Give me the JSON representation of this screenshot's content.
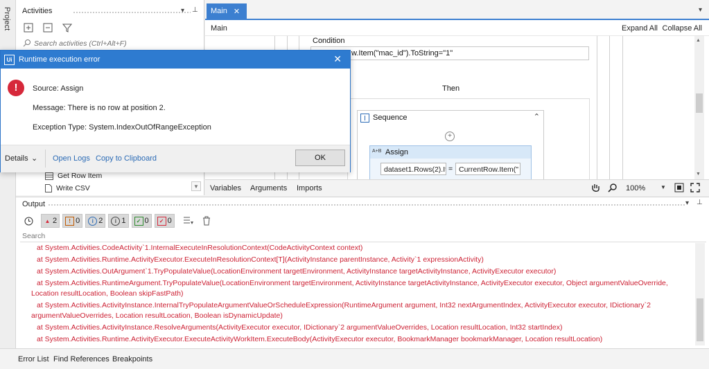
{
  "left_strip": {
    "label": "Project"
  },
  "activities": {
    "title": "Activities",
    "search_placeholder": "Search activities (Ctrl+Alt+F)",
    "items": [
      "Get Row Item",
      "Write CSV"
    ]
  },
  "designer": {
    "tab": "Main",
    "breadcrumb": "Main",
    "expand_all": "Expand All",
    "collapse_all": "Collapse All",
    "condition_label": "Condition",
    "condition_text": "w.Item(\"mac_id\").ToString=\"1\"",
    "then_label": "Then",
    "sequence_label": "Sequence",
    "assign_label": "Assign",
    "assign_icon": "A+B",
    "assign_to": "dataset1.Rows(2).It",
    "assign_eq": "=",
    "assign_value": "CurrentRow.Item(\"",
    "bottom_tabs": [
      "Variables",
      "Arguments",
      "Imports"
    ],
    "zoom": "100%"
  },
  "dialog": {
    "logo": "Ui",
    "title": "Runtime execution error",
    "source": "Source: Assign",
    "message": "Message: There is no row at position 2.",
    "exception": "Exception Type: System.IndexOutOfRangeException",
    "details": "Details",
    "open_logs": "Open Logs",
    "copy_clipboard": "Copy to Clipboard",
    "ok": "OK"
  },
  "output": {
    "title": "Output",
    "filters": [
      {
        "icon": "error-triangle-icon",
        "count": "2",
        "color": "#d6283a",
        "on": true
      },
      {
        "icon": "warning-icon",
        "count": "0",
        "color": "#c05a00",
        "on": true
      },
      {
        "icon": "info-icon",
        "count": "2",
        "color": "#2a6ab5",
        "on": true
      },
      {
        "icon": "trace-icon",
        "count": "1",
        "color": "#444444",
        "on": true
      },
      {
        "icon": "success-check-icon",
        "count": "0",
        "color": "#2d8a2d",
        "on": true
      },
      {
        "icon": "failed-check-icon",
        "count": "0",
        "color": "#d6283a",
        "on": true
      }
    ],
    "search_placeholder": "Search",
    "lines": [
      "at System.Activities.CodeActivity`1.InternalExecuteInResolutionContext(CodeActivityContext context)",
      "at System.Activities.Runtime.ActivityExecutor.ExecuteInResolutionContext[T](ActivityInstance parentInstance, Activity`1 expressionActivity)",
      "at System.Activities.OutArgument`1.TryPopulateValue(LocationEnvironment targetEnvironment, ActivityInstance targetActivityInstance, ActivityExecutor executor)",
      "at System.Activities.RuntimeArgument.TryPopulateValue(LocationEnvironment targetEnvironment, ActivityInstance targetActivityInstance, ActivityExecutor executor, Object argumentValueOverride, Location resultLocation, Boolean skipFastPath)",
      "at System.Activities.ActivityInstance.InternalTryPopulateArgumentValueOrScheduleExpression(RuntimeArgument argument, Int32 nextArgumentIndex, ActivityExecutor executor, IDictionary`2 argumentValueOverrides, Location resultLocation, Boolean isDynamicUpdate)",
      "at System.Activities.ActivityInstance.ResolveArguments(ActivityExecutor executor, IDictionary`2 argumentValueOverrides, Location resultLocation, Int32 startIndex)",
      "at System.Activities.Runtime.ActivityExecutor.ExecuteActivityWorkItem.ExecuteBody(ActivityExecutor executor, BookmarkManager bookmarkManager, Location resultLocation)"
    ]
  },
  "status_tabs": [
    "Error List",
    "Find References",
    "Breakpoints"
  ]
}
